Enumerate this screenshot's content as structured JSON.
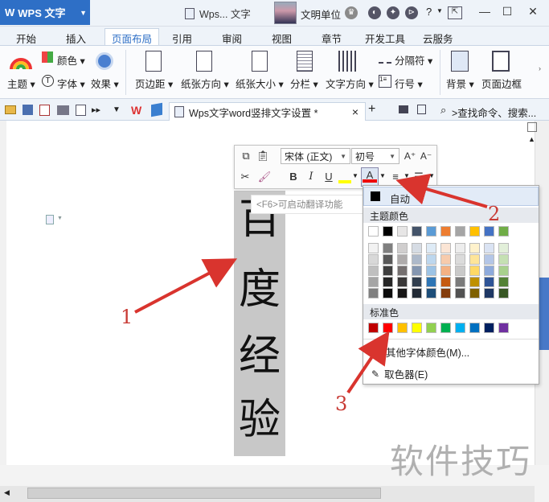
{
  "titlebar": {
    "app_name": "WPS 文字",
    "doc_title": "Wps... 文字",
    "user_name": "文明单位"
  },
  "menu_tabs": [
    "开始",
    "插入",
    "页面布局",
    "引用",
    "审阅",
    "视图",
    "章节",
    "开发工具",
    "云服务"
  ],
  "active_tab": "页面布局",
  "ribbon": {
    "theme": "主题",
    "color": "颜色",
    "font": "字体",
    "effect": "效果",
    "margin": "页边距",
    "orientation": "纸张方向",
    "size": "纸张大小",
    "columns": "分栏",
    "text_direction": "文字方向",
    "separator": "分隔符",
    "line_number": "行号",
    "background": "背景",
    "page_border": "页面边框"
  },
  "doc_tab": {
    "title": "Wps文字word竖排文字设置 *",
    "close": "×",
    "new": "+"
  },
  "search": {
    "label": ">查找命令、搜索..."
  },
  "mini_toolbar": {
    "font_name": "宋体 (正文)",
    "font_size": "初号",
    "grow": "A⁺",
    "shrink": "A⁻",
    "bold": "B",
    "italic": "I",
    "underline": "U",
    "font_color": "A"
  },
  "translate_hint": "<F6>可启动翻译功能",
  "document": {
    "vertical_chars": [
      "百",
      "度",
      "经",
      "验"
    ]
  },
  "color_dropdown": {
    "auto": "自动",
    "theme_colors": "主题颜色",
    "standard_colors": "标准色",
    "more_colors": "其他字体颜色(M)...",
    "eyedropper": "取色器(E)",
    "theme_top_row": [
      "#ffffff",
      "#000000",
      "#e7e6e6",
      "#44546a",
      "#5b9bd5",
      "#ed7d31",
      "#a5a5a5",
      "#ffc000",
      "#4472c4",
      "#70ad47"
    ],
    "theme_shades": [
      [
        "#f2f2f2",
        "#7f7f7f",
        "#d0cece",
        "#d6dce4",
        "#deebf6",
        "#fbe5d5",
        "#ededed",
        "#fff2cc",
        "#dae3f3",
        "#e2efd9"
      ],
      [
        "#d8d8d8",
        "#595959",
        "#aeabab",
        "#adb9ca",
        "#bdd7ee",
        "#f7cbac",
        "#dbdbdb",
        "#fee599",
        "#b4c6e7",
        "#c5e0b3"
      ],
      [
        "#bfbfbf",
        "#3f3f3f",
        "#757070",
        "#8496b0",
        "#9cc3e5",
        "#f4b183",
        "#c9c9c9",
        "#ffd965",
        "#8eaadb",
        "#a8d08d"
      ],
      [
        "#a5a5a5",
        "#262626",
        "#3a3838",
        "#323f4f",
        "#2e75b5",
        "#c55a11",
        "#7b7b7b",
        "#bf9000",
        "#2f5496",
        "#538135"
      ],
      [
        "#7f7f7f",
        "#0c0c0c",
        "#171616",
        "#222a35",
        "#1e4e79",
        "#843c0b",
        "#525252",
        "#7f6000",
        "#1f3864",
        "#375623"
      ]
    ],
    "standard": [
      "#c00000",
      "#ff0000",
      "#ffc000",
      "#ffff00",
      "#92d050",
      "#00b050",
      "#00b0f0",
      "#0070c0",
      "#002060",
      "#7030a0"
    ]
  },
  "annotations": [
    "1",
    "2",
    "3"
  ],
  "watermark": "软件技巧"
}
